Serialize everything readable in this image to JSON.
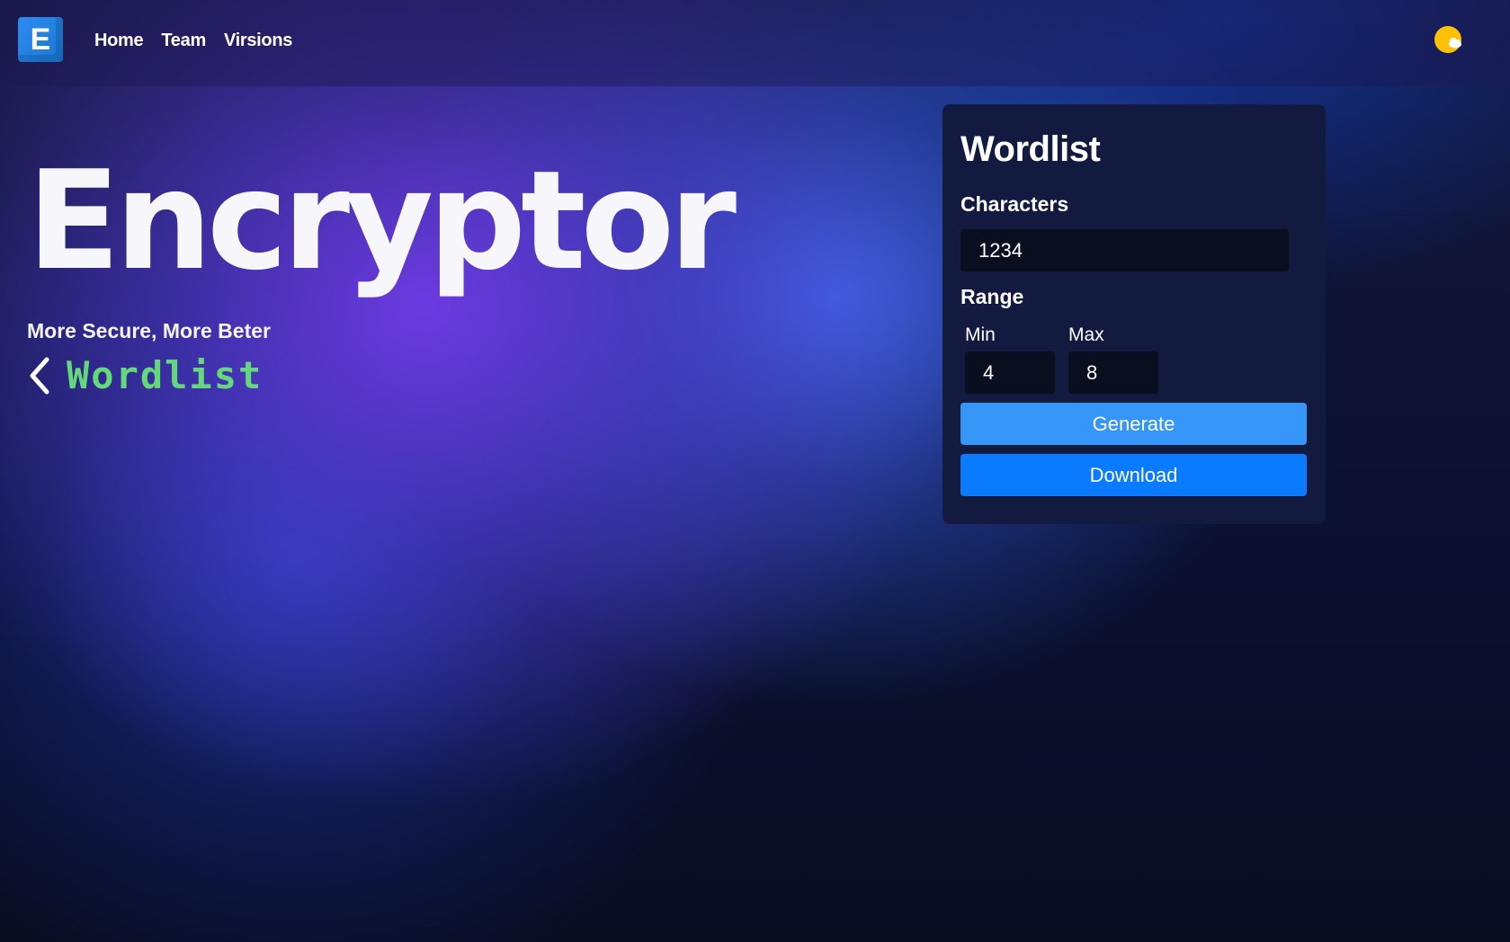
{
  "header": {
    "logo_letter": "E",
    "nav": [
      {
        "label": "Home"
      },
      {
        "label": "Team"
      },
      {
        "label": "Virsions"
      }
    ],
    "theme_toggle_icon": "sun-cloud-icon"
  },
  "hero": {
    "title": "Encryptor",
    "subtitle": "More Secure, More Beter",
    "back_icon": "chevron-left-icon",
    "section_label": "Wordlist"
  },
  "card": {
    "title": "Wordlist",
    "characters_label": "Characters",
    "characters_value": "1234",
    "range_label": "Range",
    "min_label": "Min",
    "min_value": "4",
    "max_label": "Max",
    "max_value": "8",
    "generate_label": "Generate",
    "download_label": "Download"
  },
  "colors": {
    "accent_green": "#63d97a",
    "generate_button": "#3596f8",
    "download_button": "#0a7bff",
    "card_background": "#121a40",
    "logo": "#2d8cf0"
  }
}
